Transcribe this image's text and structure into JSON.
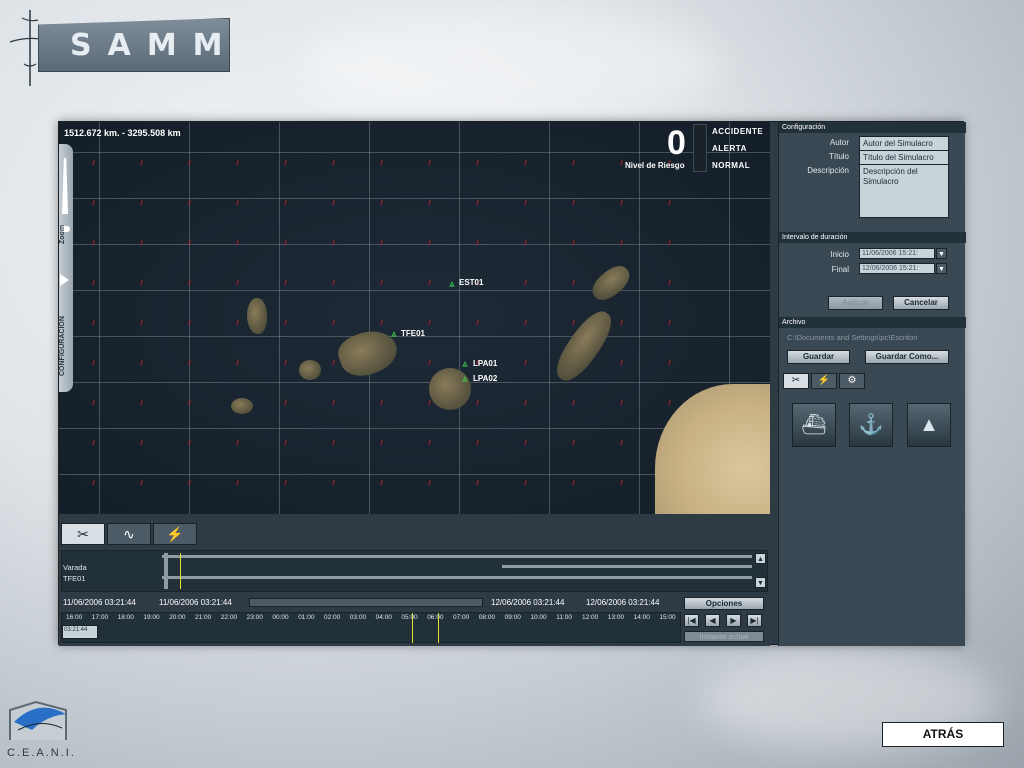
{
  "brand": {
    "title": "SAMM",
    "footer_logo": "C.E.A.N.I."
  },
  "map": {
    "coords": "1512.672 km. - 3295.508 km",
    "risk_value": "0",
    "risk_label": "Nivel de Riesgo",
    "levels": [
      "ACCIDENTE",
      "ALERTA",
      "NORMAL"
    ],
    "markers": [
      {
        "id": "EST01",
        "label": "EST01"
      },
      {
        "id": "TFE01",
        "label": "TFE01"
      },
      {
        "id": "LPA01",
        "label": "LPA01"
      },
      {
        "id": "LPA02",
        "label": "LPA02"
      }
    ]
  },
  "side_tab": {
    "zoom_label": "Zoom",
    "config_label": "CONFIGURACION"
  },
  "panel": {
    "config_header": "Configuración",
    "autor_label": "Autor",
    "autor_value": "Autor del Simulacro",
    "titulo_label": "Título",
    "titulo_value": "Título del Simulacro",
    "descripcion_label": "Descripción",
    "descripcion_value": "Descripción del Simulacro",
    "intervalo_header": "Intervalo de duración",
    "inicio_label": "Inicio",
    "inicio_value": "11/06/2006 15:21:",
    "final_label": "Final",
    "final_value": "12/06/2006 15:21:",
    "aplicar": "Aplicar",
    "cancelar": "Cancelar",
    "archivo_header": "Archivo",
    "path": "C:\\Documents and Settings\\pc\\Escritori",
    "guardar": "Guardar",
    "guardar_como": "Guardar Como..."
  },
  "bottom": {
    "track_rows": [
      "",
      "Varada",
      "TFE01"
    ],
    "start_a": "11/06/2006 03:21:44",
    "start_b": "11/06/2006 03:21:44",
    "end_a": "12/06/2006 03:21:44",
    "end_b": "12/06/2006 03:21:44",
    "opciones": "Opciones",
    "instante": "Instante actual",
    "current_time": "03:21:44",
    "ticks": [
      "16:00",
      "17:00",
      "18:00",
      "19:00",
      "20:00",
      "21:00",
      "22:00",
      "23:00",
      "00:00",
      "01:00",
      "02:00",
      "03:00",
      "04:00",
      "05:00",
      "06:00",
      "07:00",
      "08:00",
      "09:00",
      "10:00",
      "11:00",
      "12:00",
      "13:00",
      "14:00",
      "15:00"
    ]
  },
  "nav": {
    "atras": "ATRÁS"
  }
}
